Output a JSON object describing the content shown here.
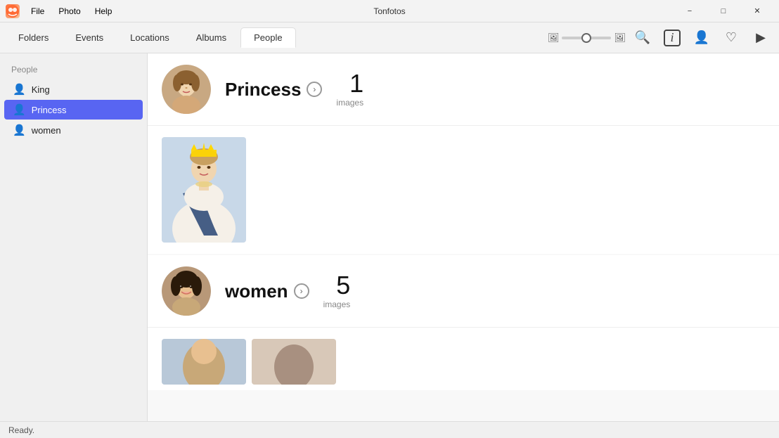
{
  "app": {
    "title": "Tonfotos",
    "icon": "🖼"
  },
  "menu": {
    "file": "File",
    "photo": "Photo",
    "help": "Help"
  },
  "window_controls": {
    "minimize": "−",
    "maximize": "□",
    "close": "✕"
  },
  "tabs": [
    {
      "id": "folders",
      "label": "Folders",
      "active": false
    },
    {
      "id": "events",
      "label": "Events",
      "active": false
    },
    {
      "id": "locations",
      "label": "Locations",
      "active": false
    },
    {
      "id": "albums",
      "label": "Albums",
      "active": false
    },
    {
      "id": "people",
      "label": "People",
      "active": true
    }
  ],
  "toolbar_icons": {
    "search": "🔍",
    "info": "ℹ",
    "face": "👤",
    "heart": "♡",
    "play": "▶"
  },
  "sidebar": {
    "section_title": "People",
    "items": [
      {
        "id": "king",
        "label": "King",
        "active": false
      },
      {
        "id": "princess",
        "label": "Princess",
        "active": true
      },
      {
        "id": "women",
        "label": "women",
        "active": false
      }
    ]
  },
  "people": [
    {
      "id": "princess",
      "name": "Princess",
      "image_count": 1,
      "images_label": "images"
    },
    {
      "id": "women",
      "name": "women",
      "image_count": 5,
      "images_label": "images"
    }
  ],
  "statusbar": {
    "text": "Ready."
  }
}
